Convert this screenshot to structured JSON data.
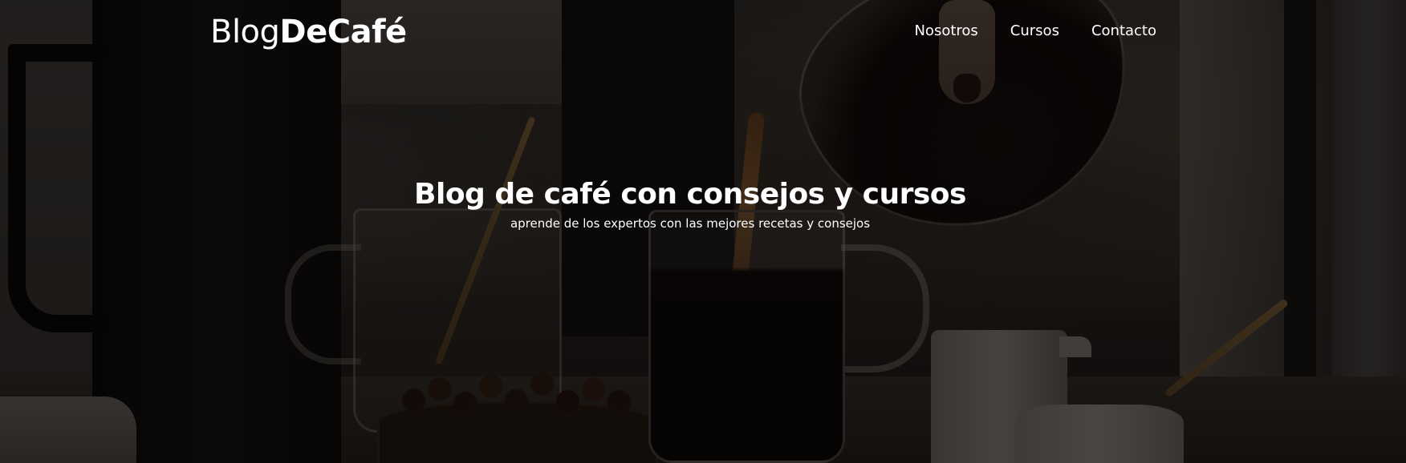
{
  "header": {
    "logo": {
      "part_light": "Blog",
      "part_bold": "DeCafé"
    },
    "nav": {
      "items": [
        {
          "label": "Nosotros"
        },
        {
          "label": "Cursos"
        },
        {
          "label": "Contacto"
        }
      ]
    }
  },
  "hero": {
    "title": "Blog de café con consejos y cursos",
    "subtitle": "aprende de los expertos con las mejores recetas y consejos",
    "overlay_color": "#000000"
  }
}
